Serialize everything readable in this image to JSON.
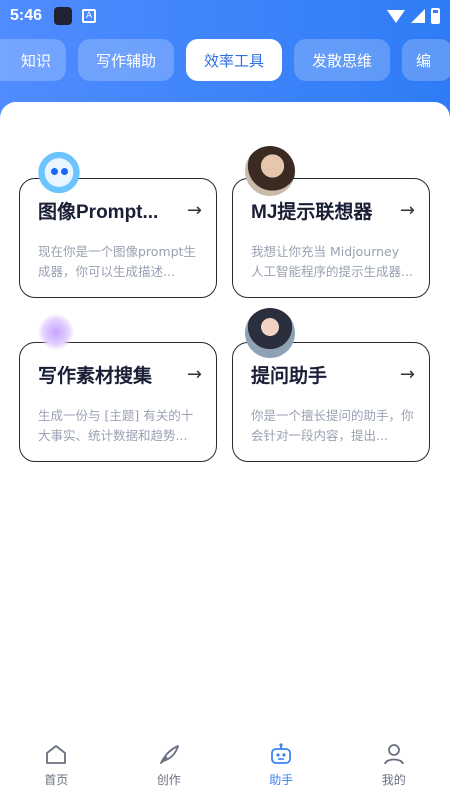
{
  "status_bar": {
    "time": "5:46",
    "app_badge": "A"
  },
  "tabs": [
    {
      "label": "知识",
      "active": false
    },
    {
      "label": "写作辅助",
      "active": false
    },
    {
      "label": "效率工具",
      "active": true
    },
    {
      "label": "发散思维",
      "active": false
    },
    {
      "label": "编",
      "active": false
    }
  ],
  "cards": [
    {
      "title": "图像Prompt...",
      "desc": "现在你是一个图像prompt生成器，你可以生成描述...",
      "avatar": "robot-avatar"
    },
    {
      "title": "MJ提示联想器",
      "desc": "我想让你充当 Midjourney 人工智能程序的提示生成器...",
      "avatar": "man-avatar"
    },
    {
      "title": "写作素材搜集",
      "desc": "生成一份与 [主题] 有关的十大事实、统计数据和趋势...",
      "avatar": "blob-avatar"
    },
    {
      "title": "提问助手",
      "desc": "你是一个擅长提问的助手，你会针对一段内容，提出...",
      "avatar": "girl-avatar"
    }
  ],
  "bottom_nav": [
    {
      "label": "首页",
      "icon": "home-icon",
      "active": false
    },
    {
      "label": "创作",
      "icon": "quill-icon",
      "active": false
    },
    {
      "label": "助手",
      "icon": "robot-icon",
      "active": true
    },
    {
      "label": "我的",
      "icon": "user-icon",
      "active": false
    }
  ],
  "colors": {
    "accent": "#3b82f6",
    "header": "#2f7cf6"
  }
}
